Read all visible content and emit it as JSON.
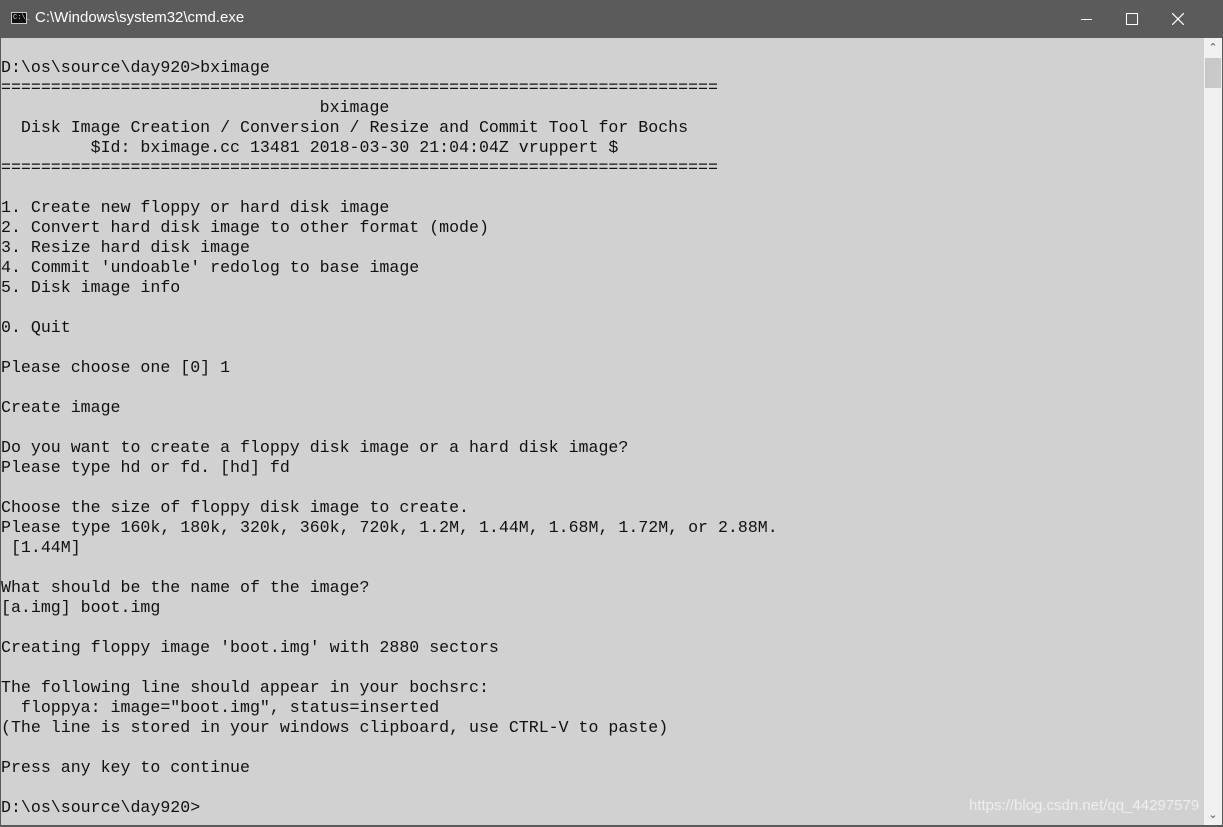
{
  "window": {
    "title": "C:\\Windows\\system32\\cmd.exe",
    "icon": "cmd-icon",
    "icon_text": "C:\\_",
    "controls": {
      "minimize": "minimize-icon",
      "maximize": "maximize-icon",
      "close": "close-icon"
    }
  },
  "console": {
    "lines": [
      "D:\\os\\source\\day920>bximage",
      "========================================================================",
      "                                bximage",
      "  Disk Image Creation / Conversion / Resize and Commit Tool for Bochs",
      "         $Id: bximage.cc 13481 2018-03-30 21:04:04Z vruppert $",
      "========================================================================",
      "",
      "1. Create new floppy or hard disk image",
      "2. Convert hard disk image to other format (mode)",
      "3. Resize hard disk image",
      "4. Commit 'undoable' redolog to base image",
      "5. Disk image info",
      "",
      "0. Quit",
      "",
      "Please choose one [0] 1",
      "",
      "Create image",
      "",
      "Do you want to create a floppy disk image or a hard disk image?",
      "Please type hd or fd. [hd] fd",
      "",
      "Choose the size of floppy disk image to create.",
      "Please type 160k, 180k, 320k, 360k, 720k, 1.2M, 1.44M, 1.68M, 1.72M, or 2.88M.",
      " [1.44M]",
      "",
      "What should be the name of the image?",
      "[a.img] boot.img",
      "",
      "Creating floppy image 'boot.img' with 2880 sectors",
      "",
      "The following line should appear in your bochsrc:",
      "  floppya: image=\"boot.img\", status=inserted",
      "(The line is stored in your windows clipboard, use CTRL-V to paste)",
      "",
      "Press any key to continue",
      "",
      "D:\\os\\source\\day920>"
    ]
  },
  "watermark": "https://blog.csdn.net/qq_44297579",
  "colors": {
    "titlebar": "#5b5b5b",
    "console_bg": "#d1d1d1",
    "console_text": "#111111"
  }
}
